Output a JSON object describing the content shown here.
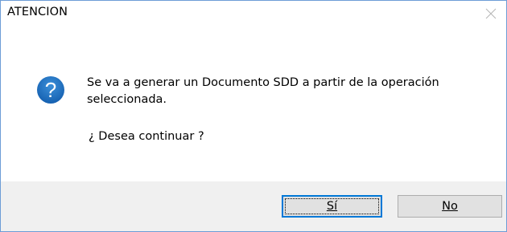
{
  "dialog": {
    "title": "ATENCION",
    "icon": "question-icon",
    "message_line1": "Se va a generar un Documento SDD a partir de la operación",
    "message_line2": "seleccionada.",
    "question": "¿ Desea continuar ?",
    "yes_label": "Sí",
    "no_label": "No",
    "accent_color": "#0078d7",
    "icon_color": "#1e73be"
  }
}
